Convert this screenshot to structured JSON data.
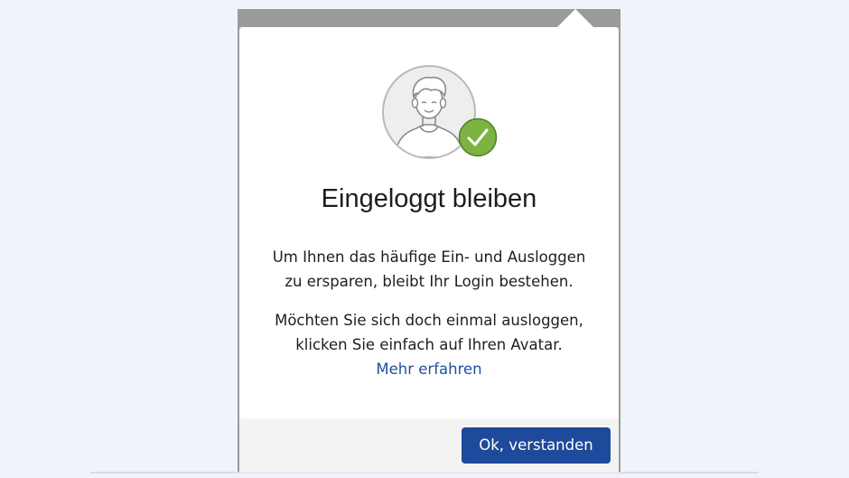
{
  "dialog": {
    "title": "Eingeloggt bleiben",
    "paragraph1": {
      "line1": "Um Ihnen das häufige Ein- und Ausloggen",
      "line2": "zu ersparen, bleibt Ihr Login bestehen."
    },
    "paragraph2": {
      "line1": "Möchten Sie sich doch einmal ausloggen,",
      "line2": "klicken Sie einfach auf Ihren Avatar."
    },
    "more_link": "Mehr erfahren",
    "ok_button": "Ok, verstanden"
  },
  "icons": {
    "avatar": "user-avatar-icon",
    "badge": "checkmark-icon"
  },
  "colors": {
    "primary_button": "#1e4a9b",
    "link": "#1f4f9e",
    "check_badge": "#7cb342",
    "backdrop": "#9a9a9a",
    "page_background": "#f0f3f9"
  }
}
